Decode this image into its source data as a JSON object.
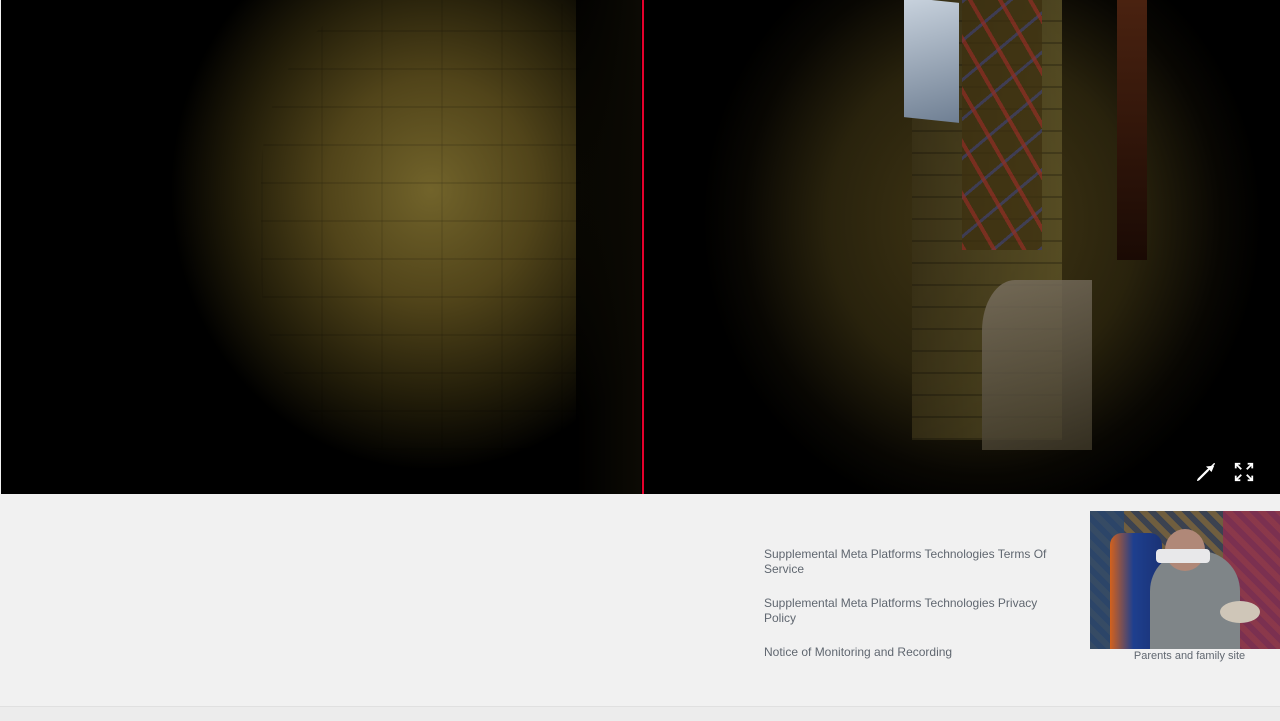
{
  "viewer": {
    "controls": [
      {
        "icon": "cast-off-icon"
      },
      {
        "icon": "fullscreen-icon"
      }
    ]
  },
  "footer": {
    "links": [
      "Supplemental Meta Platforms Technologies Terms Of Service",
      "Supplemental Meta Platforms Technologies Privacy Policy",
      "Notice of Monitoring and Recording"
    ]
  },
  "webcam": {
    "caption": "Parents and family site"
  },
  "colors": {
    "divider": "#e4002b",
    "page_background": "#f1f1f1",
    "link_text": "#606770"
  }
}
